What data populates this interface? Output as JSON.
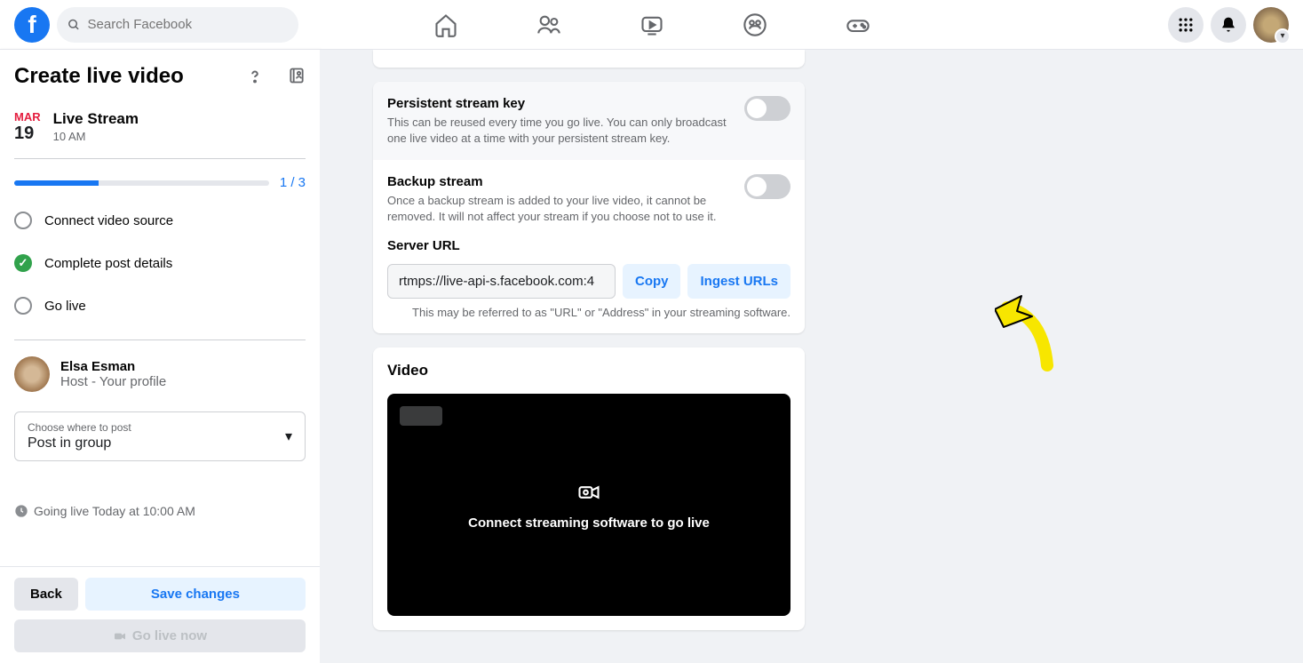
{
  "topbar": {
    "search_placeholder": "Search Facebook"
  },
  "sidebar": {
    "title": "Create live video",
    "date_month": "MAR",
    "date_day": "19",
    "stream_title": "Live Stream",
    "stream_time": "10 AM",
    "progress_text": "1 / 3",
    "steps": {
      "connect": "Connect video source",
      "complete": "Complete post details",
      "golive": "Go live"
    },
    "host_name": "Elsa Esman",
    "host_sub": "Host - Your profile",
    "post_label": "Choose where to post",
    "post_value": "Post in group",
    "going_live_text": "Going live Today at 10:00 AM",
    "back_button": "Back",
    "save_button": "Save changes",
    "golive_button": "Go live now"
  },
  "main": {
    "persistent_title": "Persistent stream key",
    "persistent_desc": "This can be reused every time you go live. You can only broadcast one live video at a time with your persistent stream key.",
    "backup_title": "Backup stream",
    "backup_desc": "Once a backup stream is added to your live video, it cannot be removed. It will not affect your stream if you choose not to use it.",
    "server_url_label": "Server URL",
    "server_url_value": "rtmps://live-api-s.facebook.com:4",
    "copy_btn": "Copy",
    "ingest_btn": "Ingest URLs",
    "server_hint": "This may be referred to as \"URL\" or \"Address\" in your streaming software.",
    "video_title": "Video",
    "video_message": "Connect streaming software to go live"
  }
}
